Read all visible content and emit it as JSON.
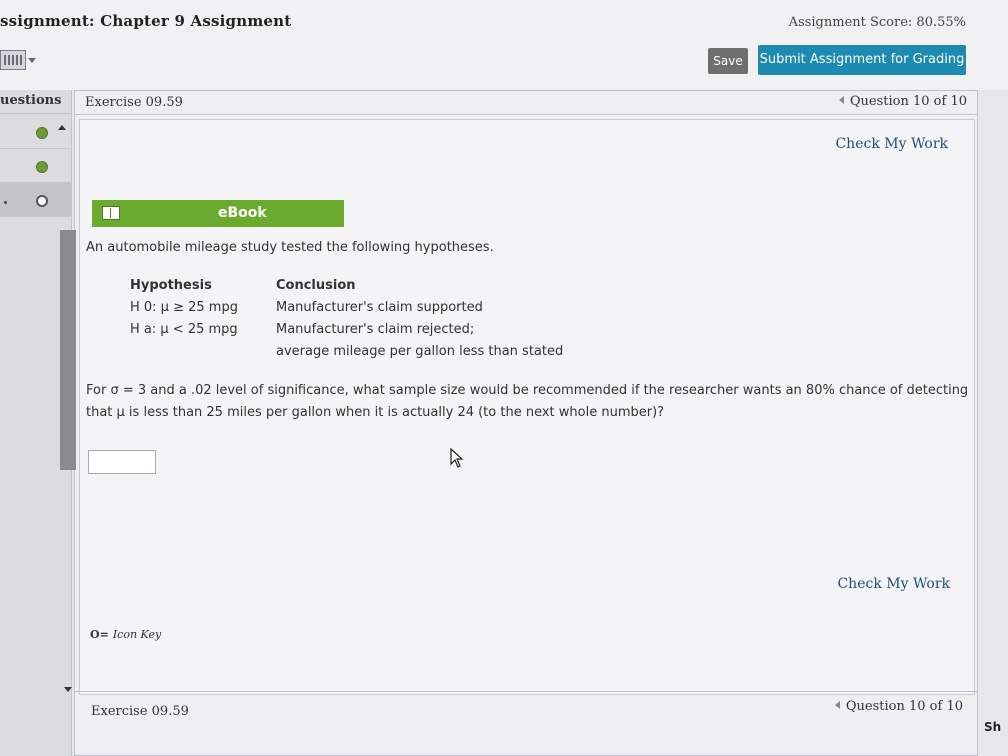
{
  "header": {
    "assignment_title": "ssignment: Chapter 9 Assignment",
    "score": "Assignment Score: 80.55%",
    "save_label": "Save",
    "submit_label": "Submit Assignment for Grading"
  },
  "sidebar": {
    "header": "uestions",
    "items": [
      {
        "status": "completed",
        "icon": "check-dot-icon"
      },
      {
        "status": "completed",
        "icon": "check-dot-icon"
      },
      {
        "status": "current",
        "icon": "open-circle-icon"
      }
    ]
  },
  "exercise": {
    "title": "Exercise 09.59",
    "question_nav": "Question 10 of 10",
    "check_work_top": "Check My Work",
    "check_work_bottom": "Check My Work",
    "ebook_label": "eBook",
    "intro": "An automobile mileage study tested the following hypotheses.",
    "table": {
      "col1_header": "Hypothesis",
      "col2_header": "Conclusion",
      "rows": [
        {
          "hyp": "H 0: μ ≥ 25 mpg",
          "conclusion": "Manufacturer's claim supported"
        },
        {
          "hyp": "H a: μ < 25 mpg",
          "conclusion": "Manufacturer's claim rejected;"
        },
        {
          "hyp": "",
          "conclusion": "average mileage per gallon less than stated"
        }
      ]
    },
    "question_text": "For σ = 3 and a .02 level of significance, what sample size would be recommended if the researcher wants an 80% chance of detecting that μ is less than 25 miles per gallon when it is actually 24 (to the next whole number)?",
    "answer_value": "",
    "icon_key_label": "Icon Key",
    "footer_title": "Exercise 09.59",
    "footer_nav": "Question 10 of 10"
  },
  "edge_text": "Sh",
  "colors": {
    "submit": "#1d8ab2",
    "save": "#6f6f6f",
    "ebook": "#6aab2f",
    "link": "#1f4f82",
    "done": "#6d9a3a"
  }
}
